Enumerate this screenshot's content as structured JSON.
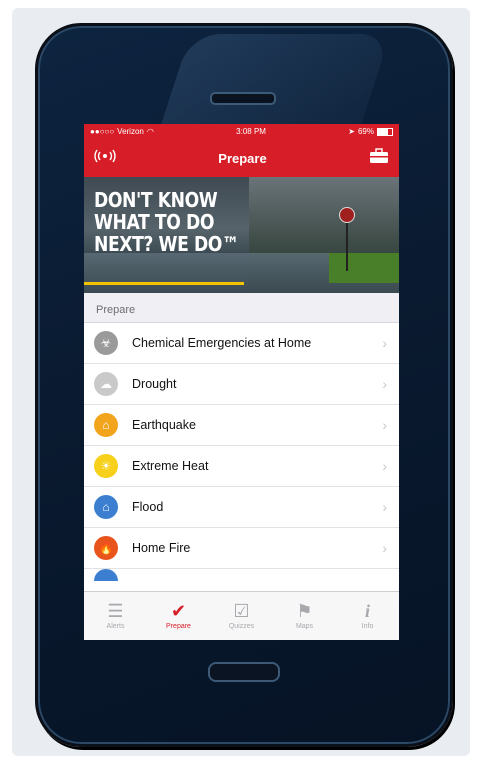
{
  "status_bar": {
    "carrier": "Verizon",
    "time": "3:08 PM",
    "battery": "69%",
    "battery_level": 0.69
  },
  "nav_bar": {
    "title": "Prepare",
    "left_icon": "alert-radio-icon",
    "right_icon": "emergency-kit-icon"
  },
  "hero": {
    "headline": "DON'T KNOW\nWHAT TO DO\nNEXT? WE DO™"
  },
  "section": {
    "header": "Prepare"
  },
  "items": [
    {
      "label": "Chemical Emergencies at Home",
      "icon": "biohazard-icon",
      "color": "#9a9a9a"
    },
    {
      "label": "Drought",
      "icon": "drought-icon",
      "color": "#c9c9c9"
    },
    {
      "label": "Earthquake",
      "icon": "earthquake-icon",
      "color": "#f2a41c"
    },
    {
      "label": "Extreme Heat",
      "icon": "sun-icon",
      "color": "#f6d01a"
    },
    {
      "label": "Flood",
      "icon": "flood-icon",
      "color": "#3c7fd0"
    },
    {
      "label": "Home Fire",
      "icon": "fire-icon",
      "color": "#e8541c"
    }
  ],
  "tabs": [
    {
      "label": "Alerts",
      "icon": "alerts-icon"
    },
    {
      "label": "Prepare",
      "icon": "checkmark-icon",
      "active": true
    },
    {
      "label": "Quizzes",
      "icon": "quiz-icon"
    },
    {
      "label": "Maps",
      "icon": "map-icon"
    },
    {
      "label": "Info",
      "icon": "info-icon"
    }
  ],
  "colors": {
    "brand_red": "#d71e28",
    "accent_yellow": "#f3c300"
  }
}
